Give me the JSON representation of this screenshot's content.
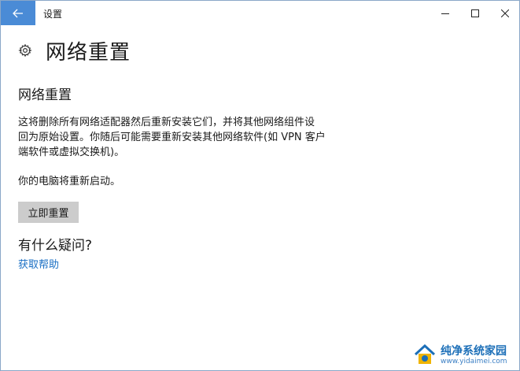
{
  "window": {
    "title": "设置",
    "controls": [
      "minimize-icon",
      "maximize-icon",
      "close-icon"
    ],
    "accent": "#4a8bd6"
  },
  "page": {
    "title": "网络重置",
    "icon": "gear-icon"
  },
  "section": {
    "title": "网络重置",
    "description_line1": "这将删除所有网络适配器然后重新安装它们，并将其他网络组件设",
    "description_line2": "回为原始设置。你随后可能需要重新安装其他网络软件(如 VPN 客户",
    "description_line3": "端软件或虚拟交换机)。",
    "restart_note": "你的电脑将重新启动。",
    "reset_button_label": "立即重置"
  },
  "help": {
    "title": "有什么疑问?",
    "link_label": "获取帮助",
    "link_color": "#1a6fc4"
  },
  "watermark": {
    "name": "纯净系统家园",
    "url": "www.yidaimei.com"
  }
}
